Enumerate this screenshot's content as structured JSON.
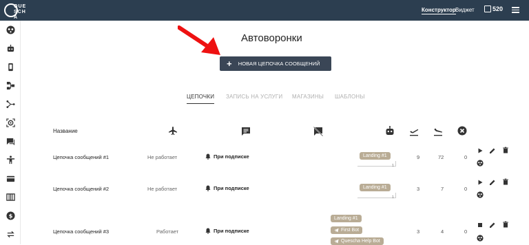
{
  "header": {
    "logo_text": "QUESCHA",
    "nav": [
      {
        "label": "Конструктор",
        "active": true
      },
      {
        "label": "Виджет",
        "active": false
      }
    ],
    "credits": "520"
  },
  "sidebar": {
    "icons": [
      "robot-face-icon",
      "bot-icon",
      "phone-icon",
      "flowchart-icon",
      "funnel-icon",
      "target-icon",
      "chat-icon",
      "person-icon",
      "card-icon",
      "table-icon",
      "dollar-icon",
      "swap-icon"
    ]
  },
  "page": {
    "title": "Автоворонки",
    "new_button": "НОВАЯ ЦЕПОЧКА СООБЩЕНИЙ"
  },
  "tabs": [
    {
      "label": "ЦЕПОЧКИ",
      "active": true
    },
    {
      "label": "ЗАПИСЬ НА УСЛУГИ",
      "active": false
    },
    {
      "label": "МАГАЗИНЫ",
      "active": false
    },
    {
      "label": "ШАБЛОНЫ",
      "active": false
    }
  ],
  "table": {
    "name_header": "Название",
    "header_icons": [
      "plane-takeoff-icon",
      "message-icon",
      "message-off-icon",
      "bot-icon",
      "departure-icon",
      "arrival-icon",
      "cancel-circle-icon"
    ],
    "rows": [
      {
        "name": "Цепочка сообщений #1",
        "status": "Не работает",
        "trigger": "При подписке",
        "tags": [
          "Landing #1"
        ],
        "tag_count": "1",
        "sent": "9",
        "received": "72",
        "cancelled": "0",
        "playing": false
      },
      {
        "name": "Цепочка сообщений #2",
        "status": "Не работает",
        "trigger": "При подписке",
        "tags": [
          "Landing #1"
        ],
        "tag_count": "1",
        "sent": "3",
        "received": "7",
        "cancelled": "0",
        "playing": false
      },
      {
        "name": "Цепочка сообщений #3",
        "status": "Работает",
        "trigger": "При подписке",
        "tags": [
          "Landing #1",
          "First Bot",
          "Quescha Help Bot"
        ],
        "tag_count": "",
        "sent": "3",
        "received": "4",
        "cancelled": "0",
        "playing": true
      }
    ]
  },
  "colors": {
    "topbar": "#2c3e50",
    "button": "#3a4656",
    "tag": "#b9ac95",
    "arrow": "#ee1111"
  }
}
